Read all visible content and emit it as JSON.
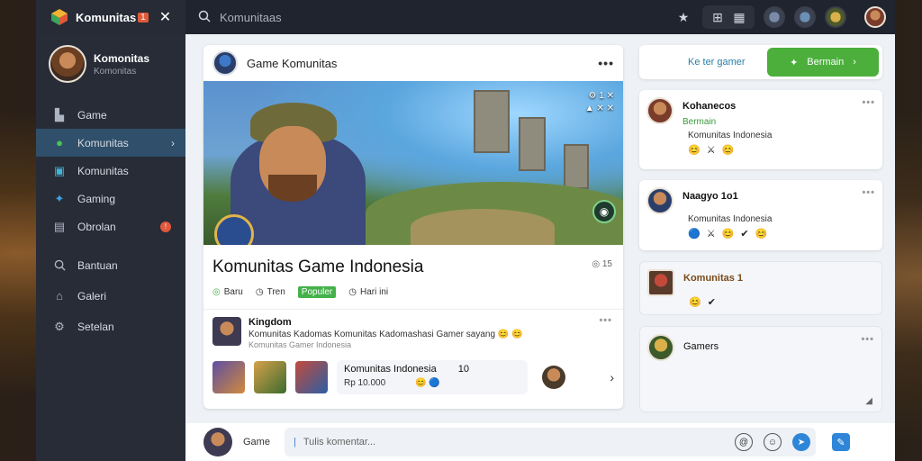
{
  "app": {
    "name": "Komunitas",
    "badge": "1",
    "close_symbol": "✕"
  },
  "search": {
    "placeholder": "Komunitaas"
  },
  "profile": {
    "name": "Komonitas",
    "subtitle": "Komonitas"
  },
  "sidebar": {
    "items": [
      {
        "label": "Game",
        "icon": "home-icon"
      },
      {
        "label": "Komunitas",
        "icon": "community-icon",
        "active": true,
        "chevron": "›"
      },
      {
        "label": "Komunitas",
        "icon": "chat-icon"
      },
      {
        "label": "Gaming",
        "icon": "bird-icon"
      },
      {
        "label": "Obrolan",
        "icon": "inbox-icon",
        "badge": "!"
      },
      {
        "label": "Bantuan",
        "icon": "search-icon"
      },
      {
        "label": "Galeri",
        "icon": "home-icon"
      },
      {
        "label": "Setelan",
        "icon": "gear-icon"
      }
    ]
  },
  "post": {
    "header_title": "Game Komunitas",
    "banner_meta_1": "⚙ 1 ✕",
    "banner_meta_2": "▲ ✕ ✕",
    "title": "Komunitas Game Indonesia",
    "title_meta": "◎ 15",
    "tags": [
      {
        "label": "Baru"
      },
      {
        "label": "Tren"
      },
      {
        "label": "Populer"
      },
      {
        "label": "Hari ini"
      }
    ],
    "comment": {
      "name": "Kingdom",
      "text": "Komunitas Kadomas Komunitas Kadomashasi Gamer sayang 😊 😊",
      "sub": "Komunitas Gamer Indonesia"
    },
    "product": {
      "title": "Komunitas Indonesia",
      "count": "10",
      "meta": "Rp 10.000"
    },
    "chevron": "›"
  },
  "right": {
    "top_label": "Ke ter gamer",
    "button_label": "Bermain",
    "button_chevron": "›",
    "cards": [
      {
        "name": "Kohanecos",
        "sub": "Bermain",
        "text": "Komunitas Indonesia",
        "emojis": "😊 ⚔   😊"
      },
      {
        "name": "Naagyo 1o1",
        "text": "Komunitas Indonesia",
        "emojis": "🔵 ⚔    😊 ✔ 😊"
      },
      {
        "name": "Komunitas 1",
        "emojis": "😊   ✔"
      },
      {
        "name": "Gamers"
      }
    ]
  },
  "bottom": {
    "label": "Game",
    "placeholder": "Tulis komentar..."
  },
  "colors": {
    "accent": "#2f86d8",
    "green": "#4caf3c",
    "sidebar": "#272c37",
    "topbar": "#20242e"
  }
}
